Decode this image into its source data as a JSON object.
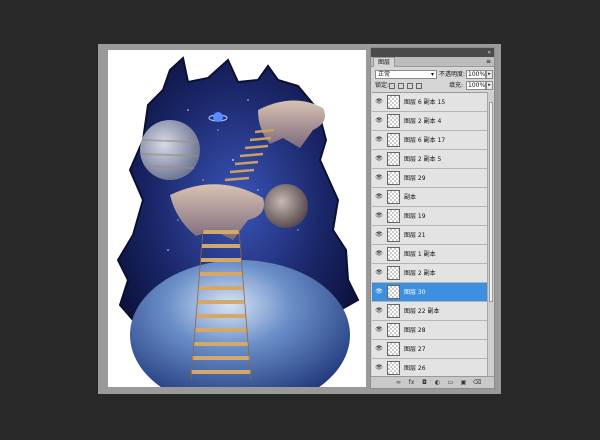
{
  "colors": {
    "background": "#282828",
    "workspace": "#9a9a9a",
    "selected_layer": "#3d8fe0"
  },
  "panel": {
    "tab_label": "图层",
    "blend_mode": "正常",
    "opacity_label": "不透明度:",
    "opacity_value": "100%",
    "lock_label": "锁定:",
    "fill_label": "填充:",
    "fill_value": "100%"
  },
  "layers": [
    {
      "name": "图层 6 副本 15",
      "selected": false
    },
    {
      "name": "图层 2 副本 4",
      "selected": false
    },
    {
      "name": "图层 6 副本 17",
      "selected": false
    },
    {
      "name": "图层 2 副本 5",
      "selected": false
    },
    {
      "name": "图层 29",
      "selected": false
    },
    {
      "name": "副本",
      "selected": false
    },
    {
      "name": "图层 19",
      "selected": false
    },
    {
      "name": "图层 21",
      "selected": false
    },
    {
      "name": "图层 1 副本",
      "selected": false
    },
    {
      "name": "图层 2 副本",
      "selected": false
    },
    {
      "name": "图层 30",
      "selected": true
    },
    {
      "name": "图层 22 副本",
      "selected": false
    },
    {
      "name": "图层 28",
      "selected": false
    },
    {
      "name": "图层 27",
      "selected": false
    },
    {
      "name": "图层 26",
      "selected": false
    }
  ],
  "footer_icons": [
    "link-icon",
    "fx-icon",
    "mask-icon",
    "adjustment-icon",
    "folder-icon",
    "new-layer-icon",
    "trash-icon"
  ]
}
